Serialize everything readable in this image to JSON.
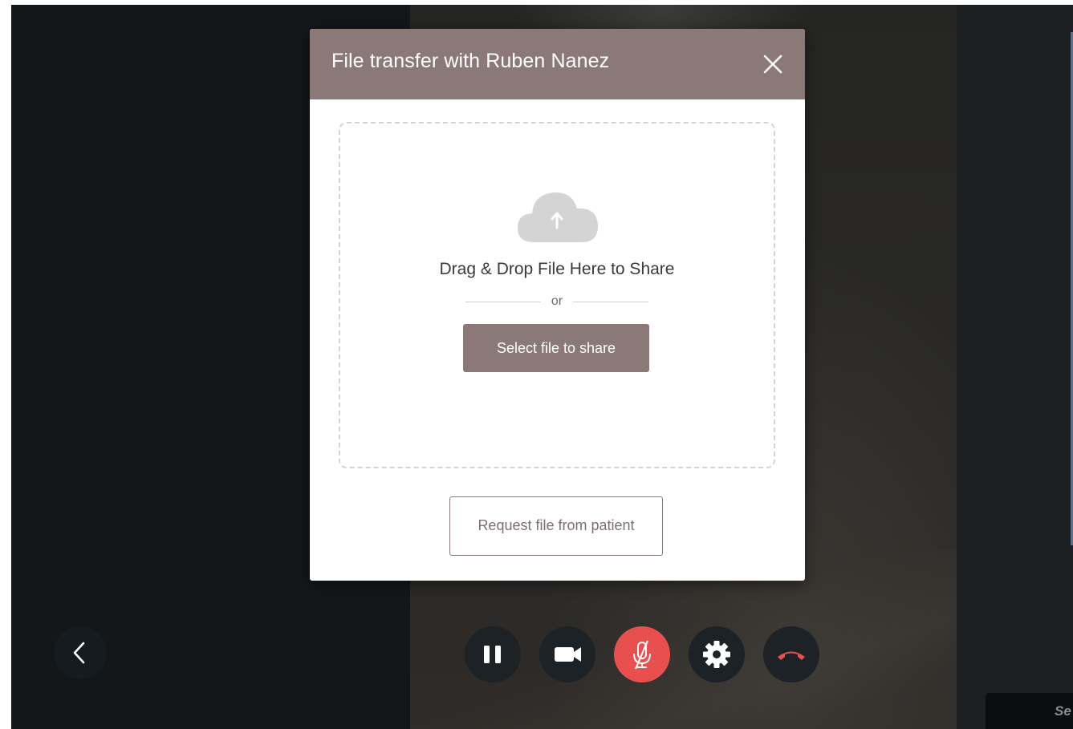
{
  "modal": {
    "title": "File transfer with Ruben Nanez",
    "drop_text": "Drag & Drop File Here to Share",
    "or_text": "or",
    "select_button": "Select file to share",
    "request_button": "Request file from patient"
  },
  "self_view": {
    "label": "Se"
  },
  "controls": {
    "back": "chevron-left-icon",
    "pause": "pause-icon",
    "camera": "video-camera-icon",
    "mic": "microphone-muted-icon",
    "settings": "gear-icon",
    "hangup": "phone-hangup-icon"
  },
  "colors": {
    "accent": "#8b7977",
    "mute_red": "#e8504f",
    "hangup_red": "#e8504f",
    "background": "#131719"
  }
}
